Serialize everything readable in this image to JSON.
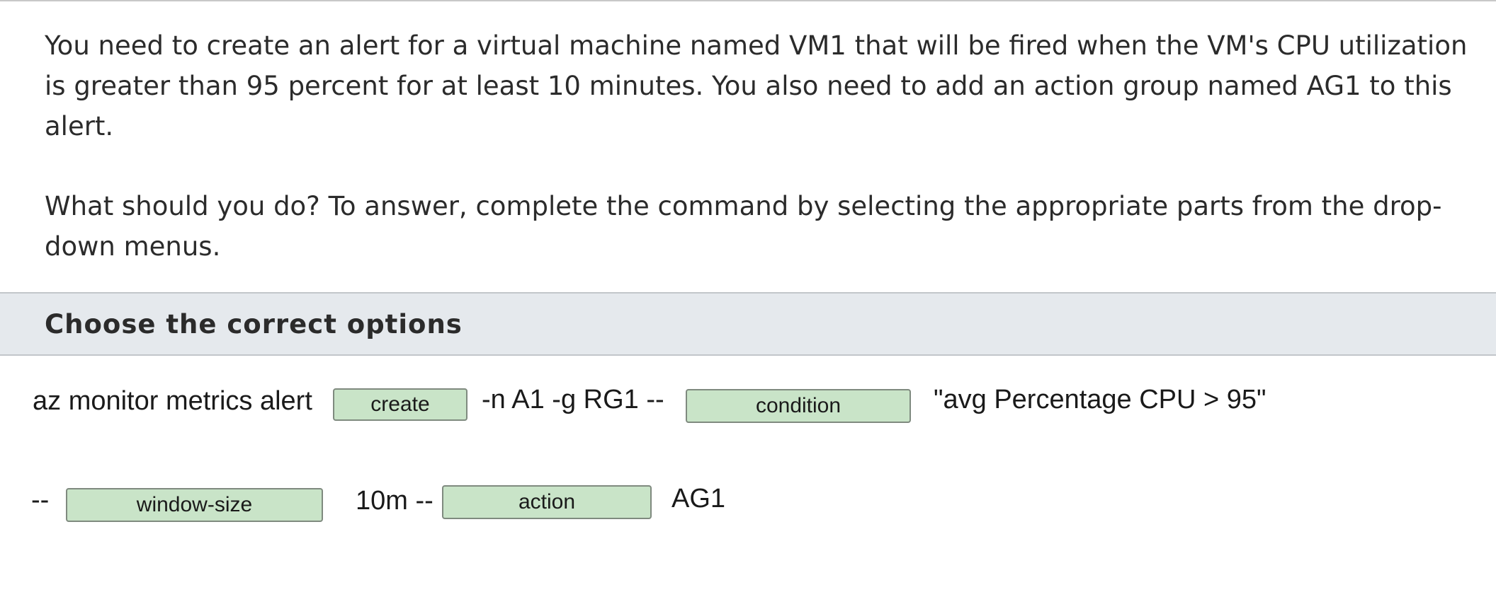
{
  "question": {
    "paragraph_1": "You need to create an alert for a virtual machine named VM1 that will be fired when the VM's CPU utilization is greater than 95 percent for at least 10 minutes. You also need to add an action group named AG1 to this alert.",
    "paragraph_2": "What should you do? To answer, complete the command by selecting the appropriate parts from the drop-down menus."
  },
  "options_header": {
    "title": "Choose the correct options"
  },
  "command": {
    "line1_prefix": "az monitor metrics alert",
    "line1_mid": "-n A1 -g RG1 --",
    "line1_suffix": "\"avg Percentage CPU > 95\"",
    "line2_prefix": "--",
    "line2_mid": "10m --",
    "line2_suffix": "AG1"
  },
  "dropdowns": {
    "verb": "create",
    "condition": "condition",
    "window": "window-size",
    "action": "action"
  }
}
